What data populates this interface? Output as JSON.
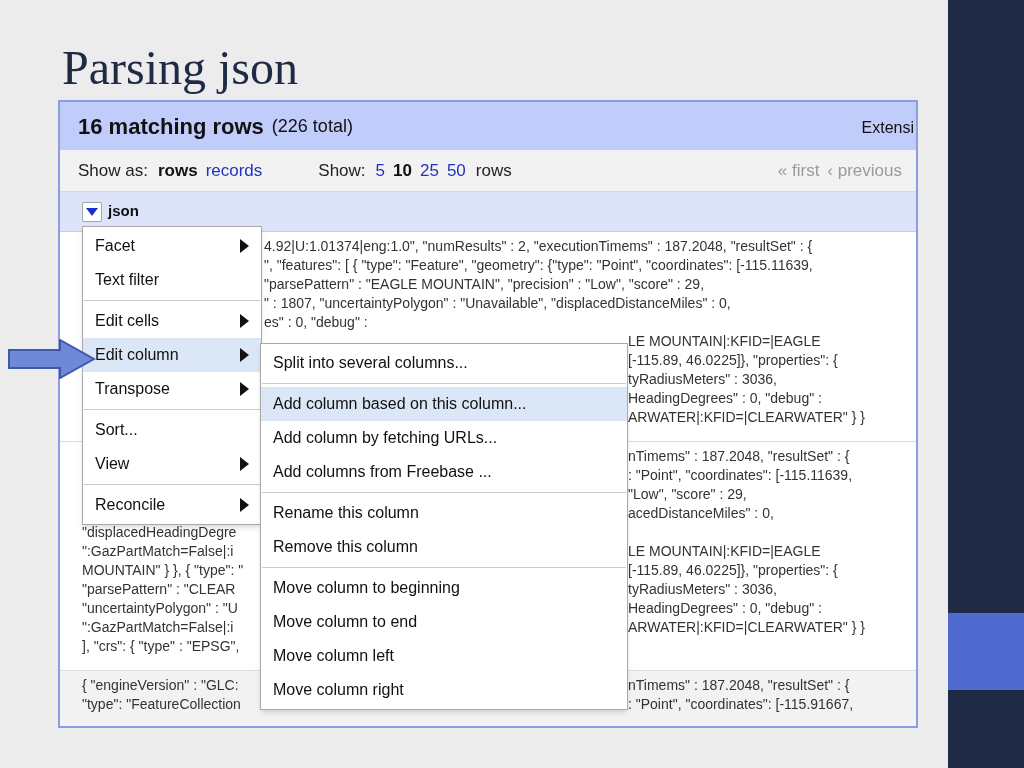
{
  "slide": {
    "title": "Parsing json"
  },
  "header": {
    "title": "16 matching rows",
    "total": "(226 total)",
    "extension": "Extensi"
  },
  "toolbar": {
    "show_as_label": "Show as:",
    "modes": [
      {
        "label": "rows",
        "selected": true
      },
      {
        "label": "records",
        "selected": false
      }
    ],
    "show_label": "Show:",
    "page_sizes": [
      {
        "label": "5",
        "selected": false
      },
      {
        "label": "10",
        "selected": true
      },
      {
        "label": "25",
        "selected": false
      },
      {
        "label": "50",
        "selected": false
      }
    ],
    "rows_label": "rows",
    "pager": [
      {
        "label": "« first",
        "disabled": true
      },
      {
        "label": "‹ previous",
        "disabled": true
      }
    ]
  },
  "column": {
    "name": "json"
  },
  "cells": [
    {
      "top_lines": [
        "4.92|U:1.01374|eng:1.0\", \"numResults\" : 2, \"executionTimems\" : 187.2048, \"resultSet\" : {",
        "\", \"features\": [ { \"type\": \"Feature\", \"geometry\": {\"type\": \"Point\", \"coordinates\": [-115.11639,",
        "\"parsePattern\" : \"EAGLE MOUNTAIN\", \"precision\" : \"Low\", \"score\" : 29,",
        "\" : 1807, \"uncertaintyPolygon\" : \"Unavailable\", \"displacedDistanceMiles\" : 0,",
        "es\" : 0, \"debug\" :"
      ],
      "lines": [
        {
          "right": "LE MOUNTAIN|:KFID=|EAGLE"
        },
        {
          "right": "[-115.89, 46.0225]}, \"properties\": {"
        },
        {
          "right": "tyRadiusMeters\" : 3036,"
        },
        {
          "right": "HeadingDegrees\" : 0, \"debug\" :"
        },
        {
          "right": "ARWATER|:KFID=|CLEARWATER\" } }"
        }
      ]
    },
    {
      "lines": [
        {
          "right": "nTimems\" : 187.2048, \"resultSet\" : {"
        },
        {
          "right": ": \"Point\", \"coordinates\": [-115.11639,"
        },
        {
          "right": "\"Low\", \"score\" : 29,"
        },
        {
          "right": "acedDistanceMiles\" : 0,"
        },
        {
          "left": "\"displacedHeadingDegre"
        },
        {
          "left": "\":GazPartMatch=False|:i",
          "right": "LE MOUNTAIN|:KFID=|EAGLE"
        },
        {
          "left": "MOUNTAIN\" } }, { \"type\": \"",
          "right": "[-115.89, 46.0225]}, \"properties\": {"
        },
        {
          "left": "\"parsePattern\" : \"CLEAR",
          "right": "tyRadiusMeters\" : 3036,"
        },
        {
          "left": "\"uncertaintyPolygon\" : \"U",
          "right": "HeadingDegrees\" : 0, \"debug\" :"
        },
        {
          "left": "\":GazPartMatch=False|:i",
          "right": "ARWATER|:KFID=|CLEARWATER\" } }"
        },
        {
          "left": "], \"crs\": { \"type\" : \"EPSG\","
        }
      ]
    },
    {
      "lines": [
        {
          "left": "{ \"engineVersion\" : \"GLC:",
          "right": "nTimems\" : 187.2048, \"resultSet\" : {"
        },
        {
          "left": "\"type\": \"FeatureCollection",
          "right": ": \"Point\", \"coordinates\": [-115.91667,"
        }
      ]
    }
  ],
  "menu": {
    "groups": [
      [
        {
          "label": "Facet",
          "submenu": true,
          "selected": false
        },
        {
          "label": "Text filter",
          "submenu": false,
          "selected": false
        }
      ],
      [
        {
          "label": "Edit cells",
          "submenu": true,
          "selected": false
        },
        {
          "label": "Edit column",
          "submenu": true,
          "selected": true
        },
        {
          "label": "Transpose",
          "submenu": true,
          "selected": false
        }
      ],
      [
        {
          "label": "Sort...",
          "submenu": false,
          "selected": false
        },
        {
          "label": "View",
          "submenu": true,
          "selected": false
        }
      ],
      [
        {
          "label": "Reconcile",
          "submenu": true,
          "selected": false
        }
      ]
    ]
  },
  "submenu": {
    "groups": [
      [
        {
          "label": "Split into several columns...",
          "selected": false
        }
      ],
      [
        {
          "label": "Add column based on this column...",
          "selected": true
        },
        {
          "label": "Add column by fetching URLs...",
          "selected": false
        },
        {
          "label": "Add columns from Freebase ...",
          "selected": false
        }
      ],
      [
        {
          "label": "Rename this column",
          "selected": false
        },
        {
          "label": "Remove this column",
          "selected": false
        }
      ],
      [
        {
          "label": "Move column to beginning",
          "selected": false
        },
        {
          "label": "Move column to end",
          "selected": false
        },
        {
          "label": "Move column left",
          "selected": false
        },
        {
          "label": "Move column right",
          "selected": false
        }
      ]
    ]
  }
}
